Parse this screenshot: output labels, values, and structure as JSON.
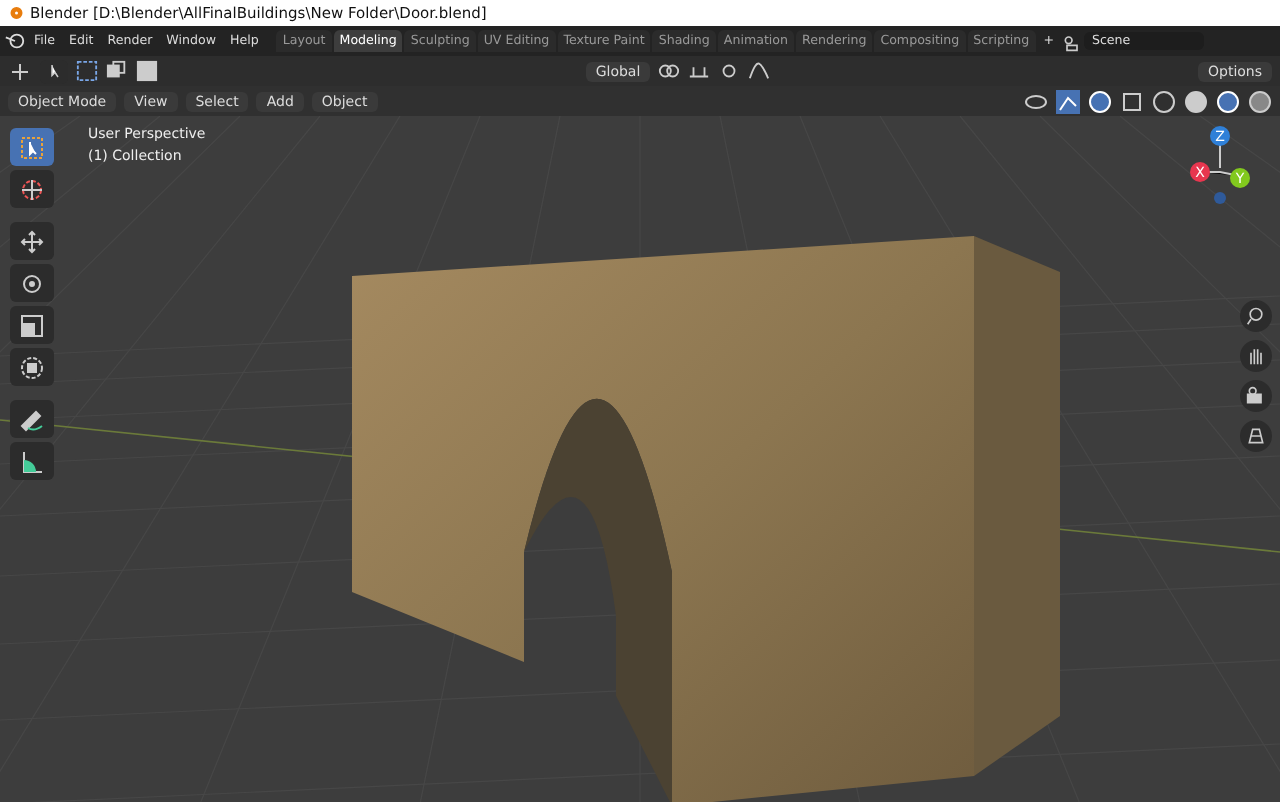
{
  "window": {
    "title": "Blender [D:\\Blender\\AllFinalBuildings\\New Folder\\Door.blend]"
  },
  "menu": [
    "File",
    "Edit",
    "Render",
    "Window",
    "Help"
  ],
  "workspaces": [
    {
      "label": "Layout",
      "selected": false
    },
    {
      "label": "Modeling",
      "selected": true
    },
    {
      "label": "Sculpting",
      "selected": false
    },
    {
      "label": "UV Editing",
      "selected": false
    },
    {
      "label": "Texture Paint",
      "selected": false
    },
    {
      "label": "Shading",
      "selected": false
    },
    {
      "label": "Animation",
      "selected": false
    },
    {
      "label": "Rendering",
      "selected": false
    },
    {
      "label": "Compositing",
      "selected": false
    },
    {
      "label": "Scripting",
      "selected": false
    }
  ],
  "add_workspace": "+",
  "scene": {
    "value": "Scene"
  },
  "tool_header": {
    "orientation": "Global",
    "options": "Options"
  },
  "viewport_header": {
    "mode": "Object Mode",
    "menus": [
      "View",
      "Select",
      "Add",
      "Object"
    ]
  },
  "viewport": {
    "perspective": "User Perspective",
    "collection": "(1) Collection"
  },
  "tools": [
    {
      "kind": "select",
      "selected": true
    },
    {
      "kind": "cursor",
      "selected": false
    },
    {
      "kind": "move",
      "selected": false
    },
    {
      "kind": "rotate",
      "selected": false
    },
    {
      "kind": "scale",
      "selected": false
    },
    {
      "kind": "transform",
      "selected": false
    },
    {
      "kind": "annotate",
      "selected": false
    },
    {
      "kind": "measure",
      "selected": false
    }
  ],
  "gizmo": {
    "x": "X",
    "y": "Y",
    "z": "Z"
  }
}
